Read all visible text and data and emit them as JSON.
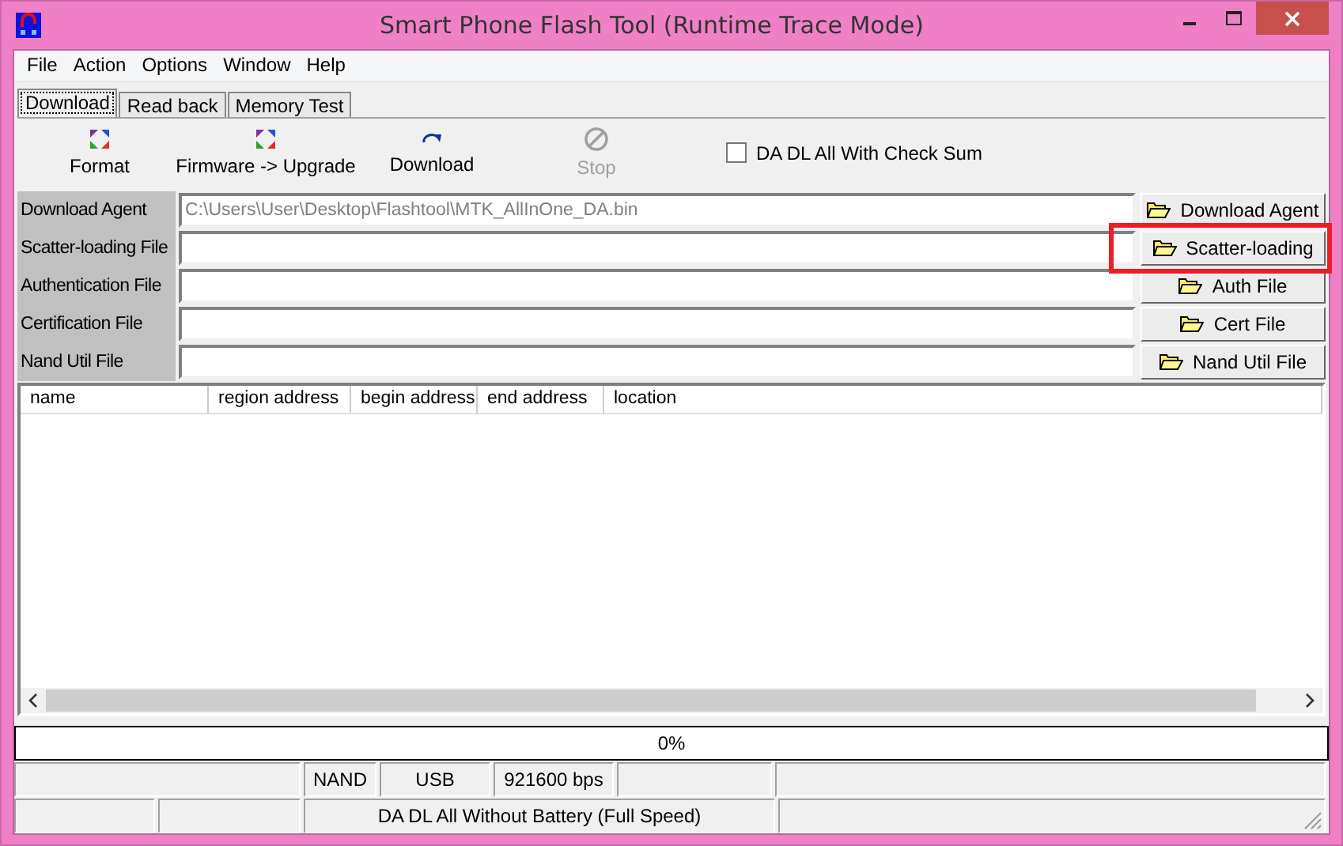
{
  "window": {
    "title": "Smart Phone Flash Tool (Runtime Trace Mode)"
  },
  "menu": [
    "File",
    "Action",
    "Options",
    "Window",
    "Help"
  ],
  "tabs": [
    {
      "label": "Download",
      "selected": true
    },
    {
      "label": "Read back",
      "selected": false
    },
    {
      "label": "Memory Test",
      "selected": false
    }
  ],
  "toolbar": [
    {
      "kind": "format",
      "label": "Format",
      "disabled": false
    },
    {
      "kind": "upgrade",
      "label": "Firmware -> Upgrade",
      "disabled": false
    },
    {
      "kind": "download",
      "label": "Download",
      "disabled": false
    },
    {
      "kind": "stop",
      "label": "Stop",
      "disabled": true
    }
  ],
  "checksum_option": {
    "label": "DA DL All With Check Sum",
    "checked": false
  },
  "files": [
    {
      "label": "Download Agent",
      "value": "C:\\Users\\User\\Desktop\\Flashtool\\MTK_AllInOne_DA.bin",
      "button": "Download Agent",
      "highlighted": false
    },
    {
      "label": "Scatter-loading File",
      "button": "Scatter-loading",
      "highlighted": true
    },
    {
      "label": "Authentication File",
      "button": "Auth File",
      "highlighted": false
    },
    {
      "label": "Certification File",
      "button": "Cert File",
      "highlighted": false
    },
    {
      "label": "Nand Util File",
      "button": "Nand Util File",
      "highlighted": false
    }
  ],
  "table": {
    "columns": [
      "name",
      "region address",
      "begin address",
      "end address",
      "location"
    ]
  },
  "progress": {
    "level": 0,
    "text": "0%"
  },
  "status_bar": {
    "storage": "NAND",
    "port": "USB",
    "baud": "921600 bps",
    "mode": "DA DL All Without Battery (Full Speed)"
  }
}
